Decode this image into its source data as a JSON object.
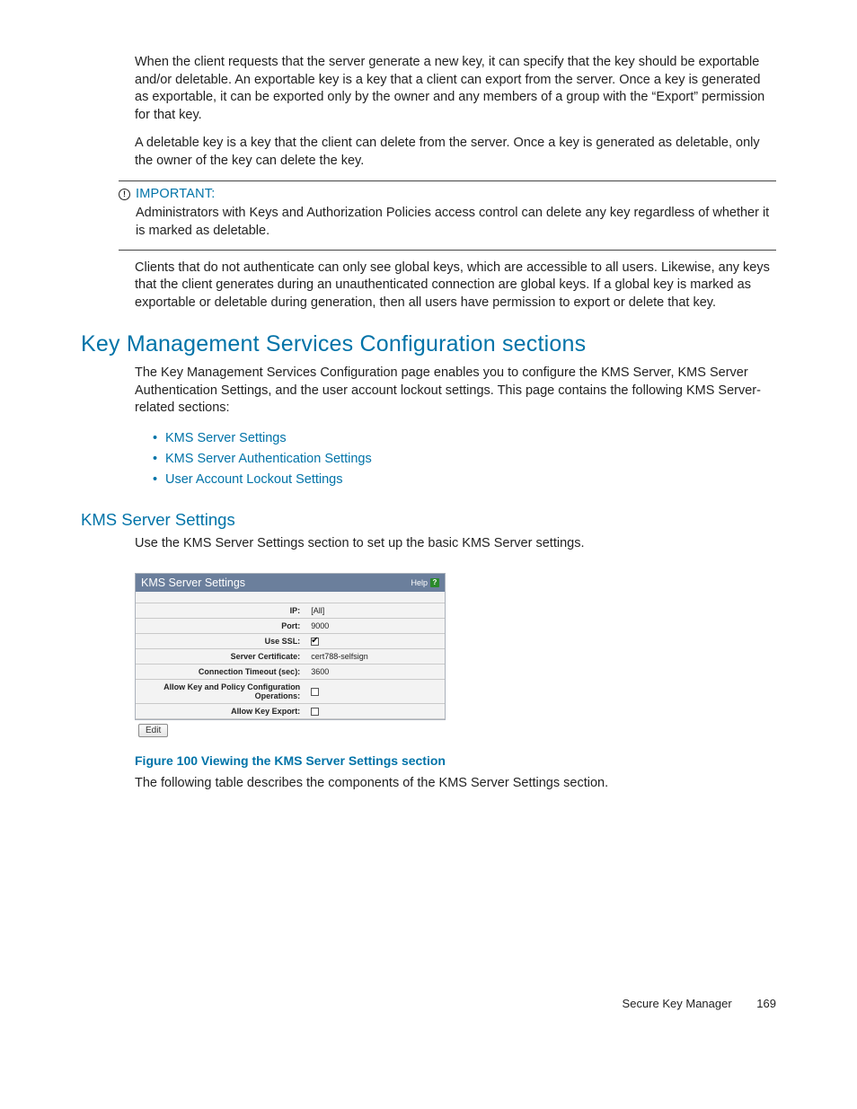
{
  "para1": "When the client requests that the server generate a new key, it can specify that the key should be exportable and/or deletable. An exportable key is a key that a client can export from the server. Once a key is generated as exportable, it can be exported only by the owner and any members of a group with the “Export” permission for that key.",
  "para2": "A deletable key is a key that the client can delete from the server. Once a key is generated as deletable, only the owner of the key can delete the key.",
  "important": {
    "label": "IMPORTANT:",
    "body": "Administrators with Keys and Authorization Policies access control can delete any key regardless of whether it is marked as deletable."
  },
  "para3": "Clients that do not authenticate can only see global keys, which are accessible to all users. Likewise, any keys that the client generates during an unauthenticated connection are global keys. If a global key is marked as exportable or deletable during generation, then all users have permission to export or delete that key.",
  "h1": "Key Management Services Configuration sections",
  "para4": "The Key Management Services Configuration page enables you to configure the KMS Server, KMS Server Authentication Settings, and the user account lockout settings. This page contains the following KMS Server-related sections:",
  "links": [
    "KMS Server Settings",
    "KMS Server Authentication Settings",
    "User Account Lockout Settings"
  ],
  "h2": "KMS Server Settings",
  "para5": "Use the KMS Server Settings section to set up the basic KMS Server settings.",
  "panel": {
    "title": "KMS Server Settings",
    "help": "Help",
    "rows": [
      {
        "label": "IP:",
        "value": "[All]"
      },
      {
        "label": "Port:",
        "value": "9000"
      },
      {
        "label": "Use SSL:",
        "value": "checkbox-checked"
      },
      {
        "label": "Server Certificate:",
        "value": "cert788-selfsign"
      },
      {
        "label": "Connection Timeout (sec):",
        "value": "3600"
      },
      {
        "label": "Allow Key and Policy Configuration Operations:",
        "value": "checkbox-unchecked"
      },
      {
        "label": "Allow Key Export:",
        "value": "checkbox-unchecked"
      }
    ],
    "edit": "Edit"
  },
  "figure_caption": "Figure 100 Viewing the KMS Server Settings section",
  "para6": "The following table describes the components of the KMS Server Settings section.",
  "footer": {
    "doc": "Secure Key Manager",
    "page": "169"
  }
}
